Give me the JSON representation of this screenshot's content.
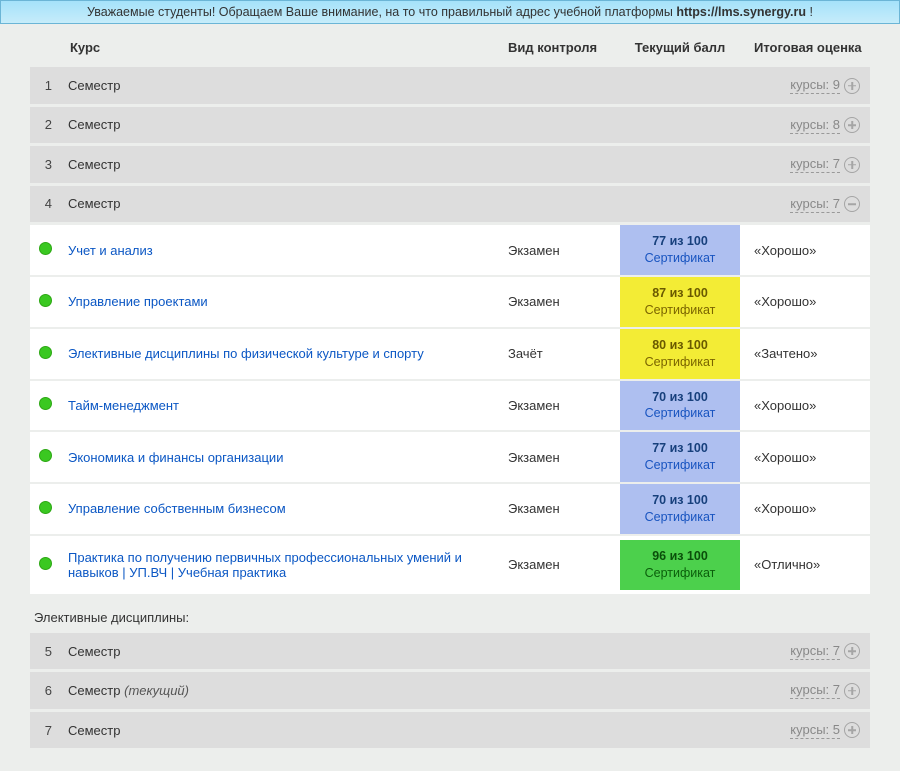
{
  "banner": {
    "prefix": "Уважаемые студенты! Обращаем Ваше внимание, на то что правильный адрес учебной платформы ",
    "url": "https://lms.synergy.ru",
    "suffix": " !"
  },
  "headers": {
    "course": "Курс",
    "control": "Вид контроля",
    "score": "Текущий балл",
    "grade": "Итоговая оценка"
  },
  "count_label_prefix": "курсы: ",
  "semester_word": "Семестр",
  "current_suffix": "(текущий)",
  "top_semesters": [
    {
      "num": "1",
      "count": "9",
      "expanded": false
    },
    {
      "num": "2",
      "count": "8",
      "expanded": false
    },
    {
      "num": "3",
      "count": "7",
      "expanded": false
    },
    {
      "num": "4",
      "count": "7",
      "expanded": true
    }
  ],
  "courses": [
    {
      "name": "Учет и анализ",
      "control": "Экзамен",
      "score": "77 из 100",
      "cert": "Сертификат",
      "color": "blue",
      "grade": "«Хорошо»"
    },
    {
      "name": "Управление проектами",
      "control": "Экзамен",
      "score": "87 из 100",
      "cert": "Сертификат",
      "color": "yellow",
      "grade": "«Хорошо»"
    },
    {
      "name": "Элективные дисциплины по физической культуре и спорту",
      "control": "Зачёт",
      "score": "80 из 100",
      "cert": "Сертификат",
      "color": "yellow",
      "grade": "«Зачтено»"
    },
    {
      "name": "Тайм-менеджмент",
      "control": "Экзамен",
      "score": "70 из 100",
      "cert": "Сертификат",
      "color": "blue",
      "grade": "«Хорошо»"
    },
    {
      "name": "Экономика и финансы организации",
      "control": "Экзамен",
      "score": "77 из 100",
      "cert": "Сертификат",
      "color": "blue",
      "grade": "«Хорошо»"
    },
    {
      "name": "Управление собственным бизнесом",
      "control": "Экзамен",
      "score": "70 из 100",
      "cert": "Сертификат",
      "color": "blue",
      "grade": "«Хорошо»"
    },
    {
      "name": "Практика по получению первичных профессиональных умений и навыков | УП.ВЧ | Учебная практика",
      "control": "Экзамен",
      "score": "96 из 100",
      "cert": "Сертификат",
      "color": "green",
      "grade": "«Отлично»"
    }
  ],
  "elective_title": "Элективные дисциплины:",
  "bottom_semesters": [
    {
      "num": "5",
      "count": "7",
      "expanded": false,
      "current": false
    },
    {
      "num": "6",
      "count": "7",
      "expanded": false,
      "current": true
    },
    {
      "num": "7",
      "count": "5",
      "expanded": false,
      "current": false
    }
  ]
}
